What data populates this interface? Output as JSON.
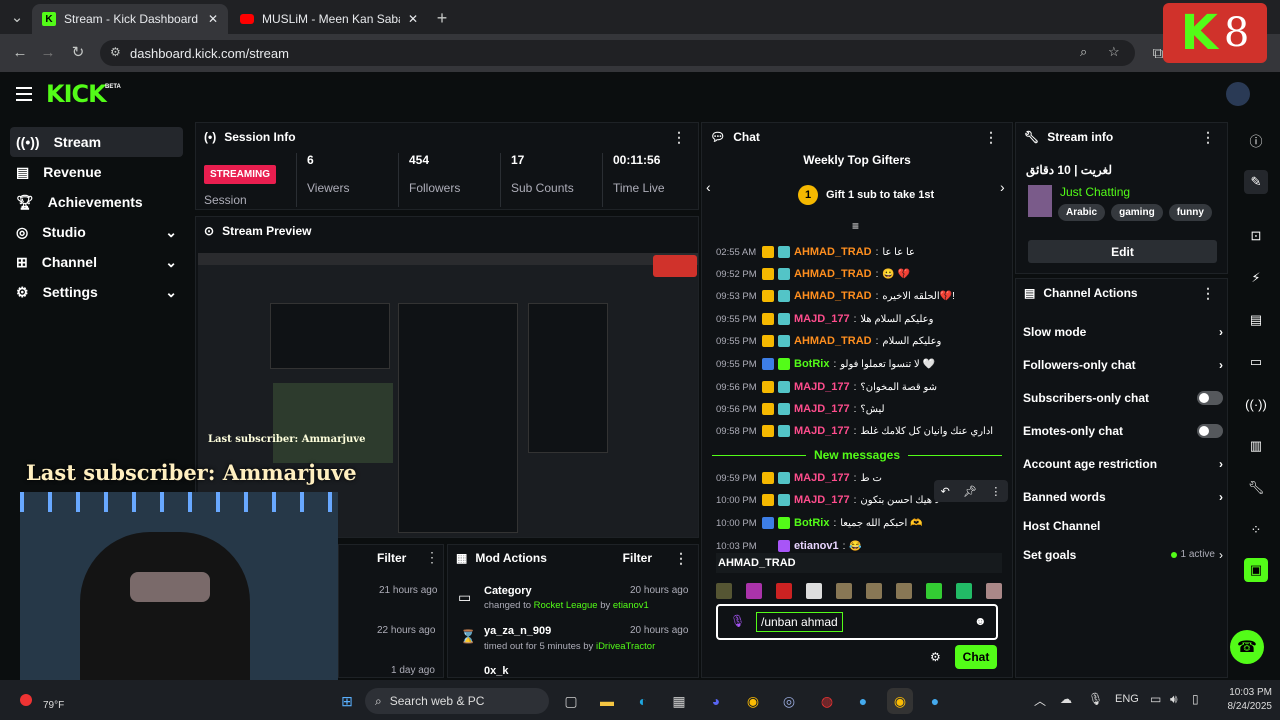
{
  "browser": {
    "tabs": [
      {
        "title": "Stream - Kick Dashboard"
      },
      {
        "title": "MUSLiM - Meen Kan Sabab | M"
      }
    ],
    "url": "dashboard.kick.com/stream",
    "new_tab": "+"
  },
  "overlay": {
    "logo_letter": "K",
    "count": "8"
  },
  "topnav": {
    "logo": "KICK",
    "beta": "BETA"
  },
  "sidebar": {
    "items": [
      {
        "label": "Stream"
      },
      {
        "label": "Revenue"
      },
      {
        "label": "Achievements"
      },
      {
        "label": "Studio"
      },
      {
        "label": "Channel"
      },
      {
        "label": "Settings"
      }
    ]
  },
  "session": {
    "title": "Session Info",
    "status": "STREAMING",
    "status_label": "Session",
    "stats": [
      {
        "value": "6",
        "label": "Viewers"
      },
      {
        "value": "454",
        "label": "Followers"
      },
      {
        "value": "17",
        "label": "Sub Counts"
      },
      {
        "value": "00:11:56",
        "label": "Time Live"
      }
    ]
  },
  "preview": {
    "title": "Stream Preview",
    "last_sub": "Last subscriber: Ammarjuve",
    "last_sub_small": "Last subscriber: Ammarjuve"
  },
  "bottom": {
    "filter": "Filter",
    "times": [
      "21 hours ago",
      "22 hours ago",
      "1 day ago"
    ]
  },
  "mod": {
    "title": "Mod Actions",
    "filter": "Filter",
    "items": [
      {
        "title": "Category",
        "desc_pre": "changed to ",
        "highlight": "Rocket League",
        "desc_mid": " by ",
        "user": "etianov1",
        "time": "20 hours ago"
      },
      {
        "title": "ya_za_n_909",
        "desc_pre": "timed out for 5 minutes by ",
        "highlight": "",
        "desc_mid": "",
        "user": "iDriveaTractor",
        "time": "20 hours ago"
      },
      {
        "title": "0x_k",
        "desc_pre": "",
        "highlight": "",
        "desc_mid": "",
        "user": "",
        "time": ""
      }
    ]
  },
  "chat": {
    "title": "Chat",
    "gifters_title": "Weekly Top Gifters",
    "gifters_text": "Gift 1 sub to take 1st",
    "rank": "1",
    "new_messages": "New messages",
    "reply_to": "AHMAD_TRAD",
    "input_value": "/unban ahmad",
    "send": "Chat",
    "messages": [
      {
        "time": "02:55 AM",
        "user": "AHMAD_TRAD",
        "color": "#ff8f1f",
        "text": "عا عا عا"
      },
      {
        "time": "09:52 PM",
        "user": "AHMAD_TRAD",
        "color": "#ff8f1f",
        "text": "😀 💔"
      },
      {
        "time": "09:53 PM",
        "user": "AHMAD_TRAD",
        "color": "#ff8f1f",
        "text": "الحلقه الاخيره💔!"
      },
      {
        "time": "09:55 PM",
        "user": "MAJD_177",
        "color": "#ff4d8d",
        "text": "وعليكم السلام هلا"
      },
      {
        "time": "09:55 PM",
        "user": "AHMAD_TRAD",
        "color": "#ff8f1f",
        "text": "وعليكم السلام"
      },
      {
        "time": "09:55 PM",
        "user": "BotRix",
        "color": "#53fc18",
        "text": "لا تنسوا تعملوا فولو 🤍"
      },
      {
        "time": "09:56 PM",
        "user": "MAJD_177",
        "color": "#ff4d8d",
        "text": "شو قصة المخوان؟"
      },
      {
        "time": "09:56 PM",
        "user": "MAJD_177",
        "color": "#ff4d8d",
        "text": "ليش؟"
      },
      {
        "time": "09:58 PM",
        "user": "MAJD_177",
        "color": "#ff4d8d",
        "text": "اداري عنك وانيان كل كلامك غلط"
      },
      {
        "time": "09:59 PM",
        "user": "MAJD_177",
        "color": "#ff4d8d",
        "text": "ت ط"
      },
      {
        "time": "10:00 PM",
        "user": "MAJD_177",
        "color": "#ff4d8d",
        "text": "لا هيك احسن بتكون"
      },
      {
        "time": "10:00 PM",
        "user": "BotRix",
        "color": "#53fc18",
        "text": "احبكم الله جميعا 🫶"
      },
      {
        "time": "10:03 PM",
        "user": "etianov1",
        "color": "#e9d5ff",
        "text": "😂"
      }
    ]
  },
  "stream_info": {
    "title": "Stream info",
    "stream_title": "لغريت | 10 دقائق",
    "category": "Just Chatting",
    "tags": [
      "Arabic",
      "gaming",
      "funny"
    ],
    "edit": "Edit"
  },
  "channel_actions": {
    "title": "Channel Actions",
    "rows": [
      {
        "label": "Slow mode"
      },
      {
        "label": "Followers-only chat"
      },
      {
        "label": "Subscribers-only chat"
      },
      {
        "label": "Emotes-only chat"
      },
      {
        "label": "Account age restriction"
      },
      {
        "label": "Banned words"
      },
      {
        "label": "Host Channel"
      },
      {
        "label": "Set goals"
      }
    ],
    "goals_status": "1 active"
  },
  "taskbar": {
    "search": "Search web & PC",
    "weather": "79°F",
    "lang": "ENG",
    "time": "10:03 PM",
    "date": "8/24/2025"
  }
}
